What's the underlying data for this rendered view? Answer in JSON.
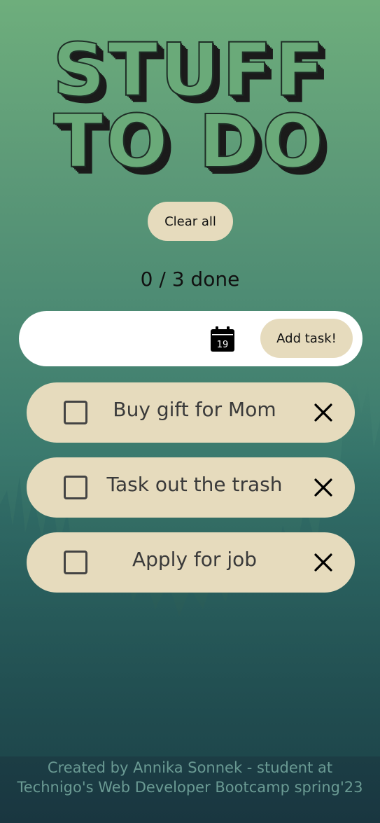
{
  "header": {
    "title_line1": "STUFF",
    "title_line2": "TO DO"
  },
  "controls": {
    "clear_label": "Clear all",
    "add_label": "Add task!",
    "input_value": "",
    "calendar_day": "19"
  },
  "counter": {
    "text": "0 / 3 done"
  },
  "tasks": [
    {
      "label": "Buy gift for Mom",
      "done": false
    },
    {
      "label": "Task out the trash",
      "done": false
    },
    {
      "label": "Apply for job",
      "done": false
    }
  ],
  "footer": {
    "line1": "Created by Annika Sonnek - student at",
    "line2": "Technigo's Web Developer Bootcamp spring'23"
  }
}
